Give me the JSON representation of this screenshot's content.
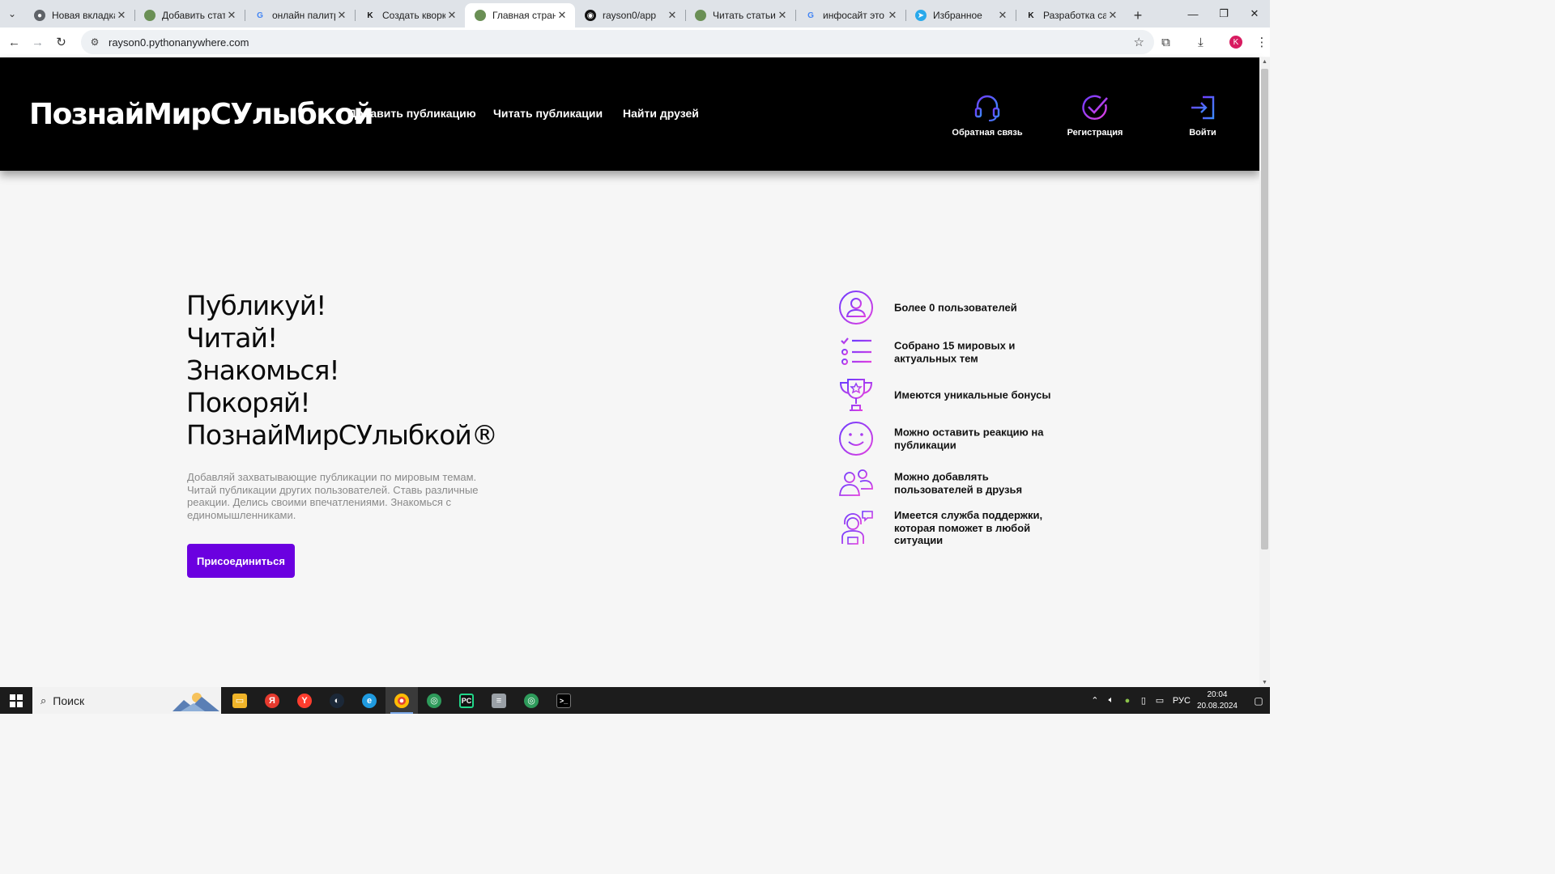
{
  "browser": {
    "tabs": [
      {
        "title": "Новая вкладка",
        "favicon": "chrome-icon",
        "active": false
      },
      {
        "title": "Добавить статью",
        "favicon": "site-icon",
        "active": false
      },
      {
        "title": "онлайн палитра",
        "favicon": "google-icon",
        "active": false
      },
      {
        "title": "Создать кворк - К",
        "favicon": "kwork-icon",
        "active": false
      },
      {
        "title": "Главная страница",
        "favicon": "site-icon",
        "active": true
      },
      {
        "title": "rayson0/app",
        "favicon": "github-icon",
        "active": false
      },
      {
        "title": "Читать статьи",
        "favicon": "site-icon",
        "active": false
      },
      {
        "title": "инфосайт это - П",
        "favicon": "google-icon",
        "active": false
      },
      {
        "title": "Избранное",
        "favicon": "telegram-icon",
        "active": false
      },
      {
        "title": "Разработка сайта",
        "favicon": "kwork-icon",
        "active": false
      }
    ],
    "url": "rayson0.pythonanywhere.com",
    "profile_initial": "K"
  },
  "site": {
    "logo": "ПознайМирСУлыбкой",
    "nav": {
      "add": "Добавить публикацию",
      "read": "Читать публикации",
      "friends": "Найти друзей"
    },
    "actions": {
      "feedback": "Обратная связь",
      "register": "Регистрация",
      "login": "Войти"
    },
    "hero": {
      "lines": [
        "Публикуй!",
        "Читай!",
        "Знакомься!",
        "Покоряй!",
        "ПознайМирСУлыбкой®"
      ],
      "description": "Добавляй захватывающие публикации по мировым темам. Читай публикации других пользователей. Ставь различные реакции. Делись своими впечатлениями. Знакомься с единомышленниками.",
      "button": "Присоединиться"
    },
    "features": [
      {
        "icon": "user-circle-icon",
        "text": "Более 0 пользователей"
      },
      {
        "icon": "checklist-icon",
        "text": "Собрано 15 мировых и актуальных тем"
      },
      {
        "icon": "trophy-icon",
        "text": "Имеются уникальные бонусы"
      },
      {
        "icon": "smiley-icon",
        "text": "Можно оставить реакцию на публикации"
      },
      {
        "icon": "friends-icon",
        "text": "Можно добавлять пользователей в друзья"
      },
      {
        "icon": "support-agent-icon",
        "text": "Имеется служба поддержки, которая поможет в любой ситуации"
      }
    ],
    "colors": {
      "accent": "#6b00e0",
      "gradient_start": "#6f3cff",
      "gradient_end": "#e040e0"
    }
  },
  "taskbar": {
    "search_placeholder": "Поиск",
    "language": "РУС",
    "time": "20:04",
    "date": "20.08.2024"
  }
}
